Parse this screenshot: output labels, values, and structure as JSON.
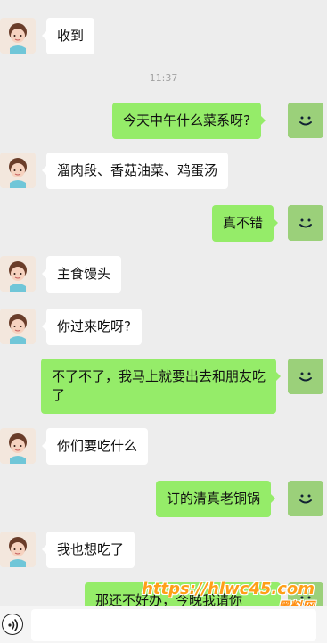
{
  "timestamp": "11:37",
  "messages": [
    {
      "side": "left",
      "text": "收到"
    },
    {
      "side": "right",
      "text": "今天中午什么菜系呀?"
    },
    {
      "side": "left",
      "text": "溜肉段、香菇油菜、鸡蛋汤"
    },
    {
      "side": "right",
      "text": "真不错"
    },
    {
      "side": "left",
      "text": "主食馒头"
    },
    {
      "side": "left",
      "text": "你过来吃呀?"
    },
    {
      "side": "right",
      "text": "不了不了，我马上就要出去和朋友吃了"
    },
    {
      "side": "left",
      "text": "你们要吃什么"
    },
    {
      "side": "right",
      "text": "订的清真老铜锅"
    },
    {
      "side": "left",
      "text": "我也想吃了"
    },
    {
      "side": "right",
      "text": "那还不好办，今晚我请你"
    }
  ],
  "watermark": {
    "url": "https://hlwc45.com",
    "name": "黑料网"
  },
  "icons": {
    "avatar_left": "cartoon-girl-avatar-icon",
    "avatar_right": "smiley-face-avatar-icon",
    "voice": "voice-wave-icon"
  },
  "colors": {
    "background": "#ededed",
    "left_bubble": "#ffffff",
    "right_bubble": "#95ec69",
    "right_avatar": "#9bd07a"
  }
}
